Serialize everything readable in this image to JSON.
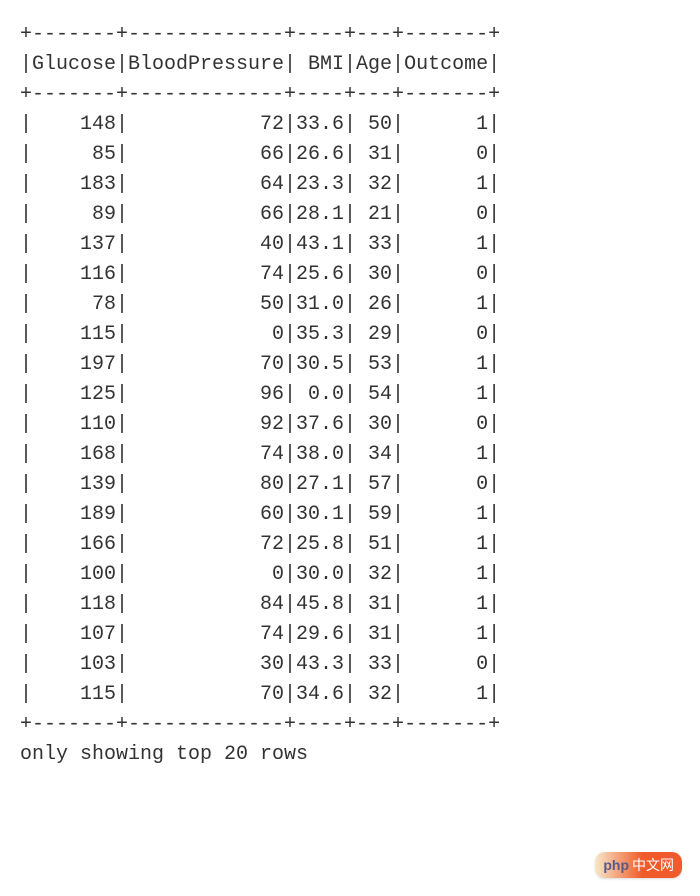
{
  "table": {
    "columns": [
      "Glucose",
      "BloodPressure",
      "BMI",
      "Age",
      "Outcome"
    ],
    "widths": [
      7,
      13,
      4,
      3,
      7
    ],
    "rows": [
      [
        "148",
        "72",
        "33.6",
        "50",
        "1"
      ],
      [
        "85",
        "66",
        "26.6",
        "31",
        "0"
      ],
      [
        "183",
        "64",
        "23.3",
        "32",
        "1"
      ],
      [
        "89",
        "66",
        "28.1",
        "21",
        "0"
      ],
      [
        "137",
        "40",
        "43.1",
        "33",
        "1"
      ],
      [
        "116",
        "74",
        "25.6",
        "30",
        "0"
      ],
      [
        "78",
        "50",
        "31.0",
        "26",
        "1"
      ],
      [
        "115",
        "0",
        "35.3",
        "29",
        "0"
      ],
      [
        "197",
        "70",
        "30.5",
        "53",
        "1"
      ],
      [
        "125",
        "96",
        "0.0",
        "54",
        "1"
      ],
      [
        "110",
        "92",
        "37.6",
        "30",
        "0"
      ],
      [
        "168",
        "74",
        "38.0",
        "34",
        "1"
      ],
      [
        "139",
        "80",
        "27.1",
        "57",
        "0"
      ],
      [
        "189",
        "60",
        "30.1",
        "59",
        "1"
      ],
      [
        "166",
        "72",
        "25.8",
        "51",
        "1"
      ],
      [
        "100",
        "0",
        "30.0",
        "32",
        "1"
      ],
      [
        "118",
        "84",
        "45.8",
        "31",
        "1"
      ],
      [
        "107",
        "74",
        "29.6",
        "31",
        "1"
      ],
      [
        "103",
        "30",
        "43.3",
        "33",
        "0"
      ],
      [
        "115",
        "70",
        "34.6",
        "32",
        "1"
      ]
    ]
  },
  "footer": "only showing top 20 rows",
  "watermark": {
    "brand": "php",
    "suffix": "中文网"
  }
}
